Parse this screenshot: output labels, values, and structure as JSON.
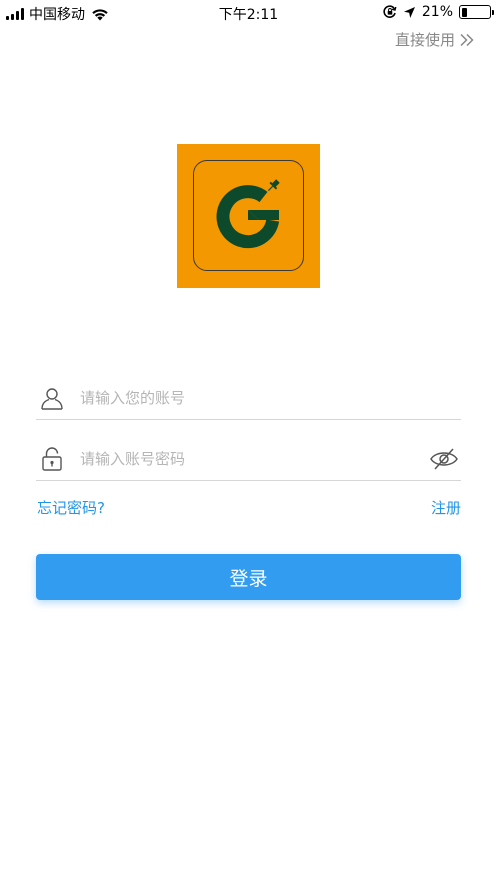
{
  "status_bar": {
    "carrier": "中国移动",
    "time": "下午2:11",
    "battery_percent": "21%",
    "battery_level": 0.21,
    "icons": [
      "signal-icon",
      "wifi-icon",
      "orientation-lock-icon",
      "location-icon",
      "battery-icon"
    ]
  },
  "skip": {
    "label": "直接使用",
    "icon": "double-chevron-right-icon"
  },
  "logo": {
    "background": "#f39800",
    "mark_color": "#0d4a2c"
  },
  "form": {
    "username_placeholder": "请输入您的账号",
    "password_placeholder": "请输入账号密码",
    "forgot_label": "忘记密码?",
    "register_label": "注册",
    "login_label": "登录"
  },
  "colors": {
    "accent": "#2196e8",
    "button": "#329cf1"
  }
}
